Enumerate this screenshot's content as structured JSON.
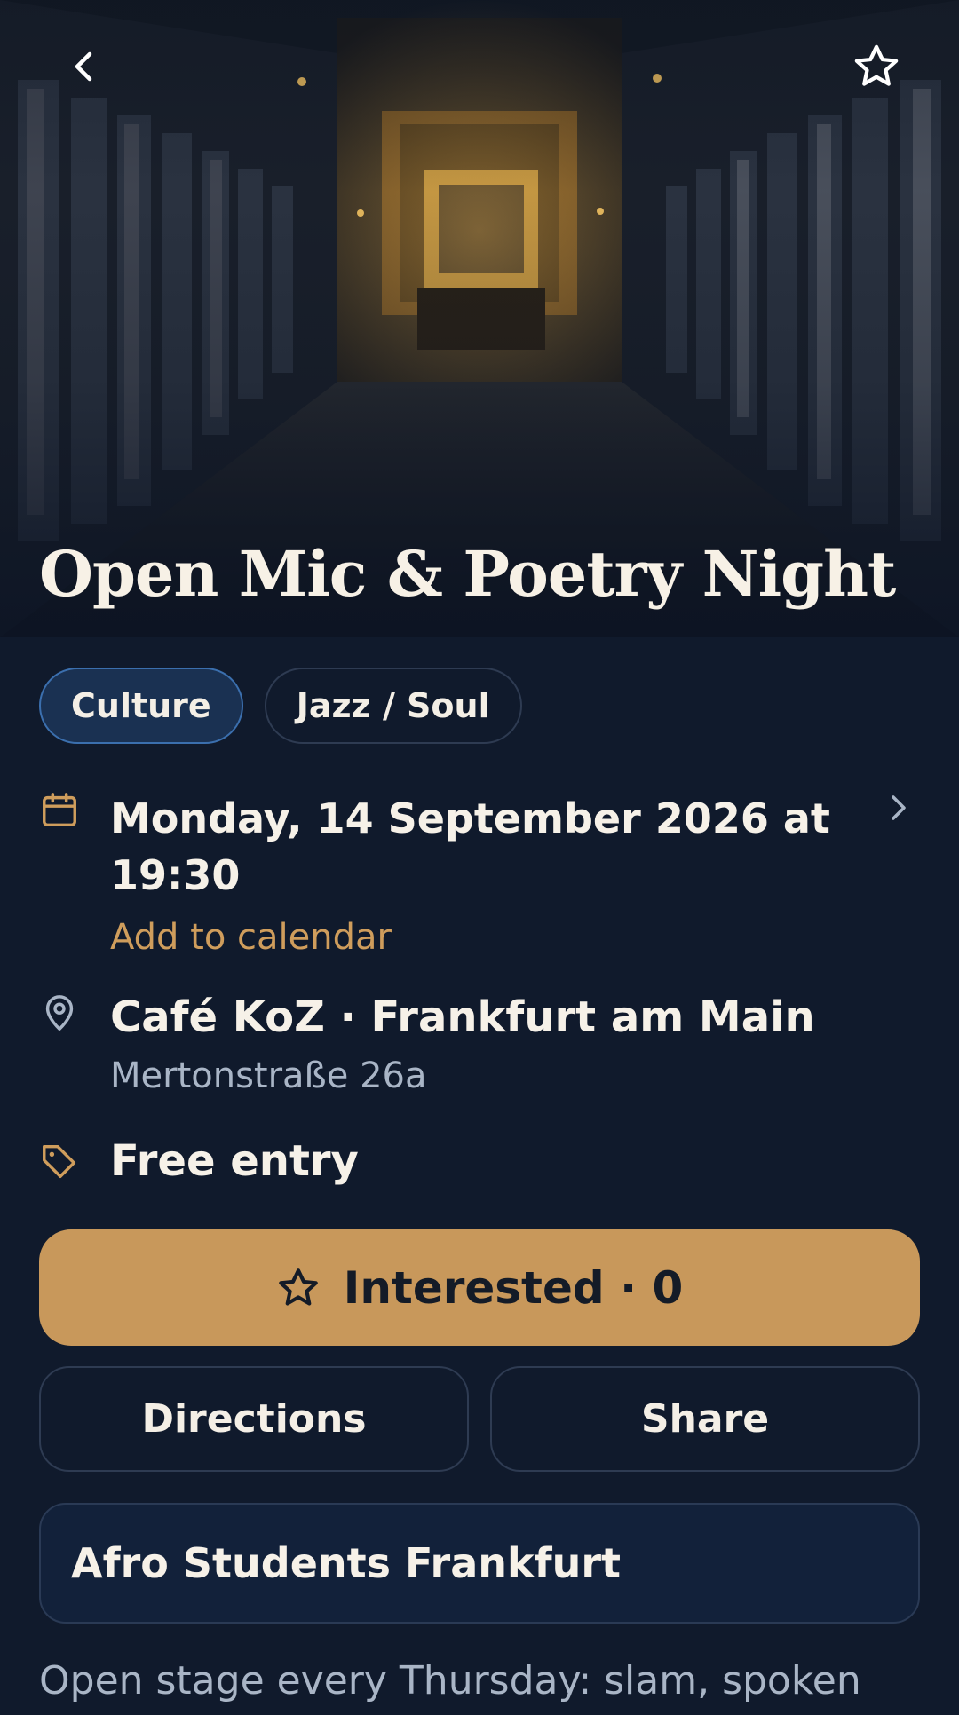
{
  "event": {
    "title": "Open Mic & Poetry Night",
    "tags": [
      "Culture",
      "Jazz / Soul"
    ],
    "datetime": "Monday, 14 September 2026 at 19:30",
    "add_to_calendar": "Add to calendar",
    "venue": "Café KoZ · Frankfurt am Main",
    "address": "Mertonstraße 26a",
    "price": "Free entry",
    "organizer": "Afro Students Frankfurt",
    "description": "Open stage every Thursday: slam, spoken"
  },
  "actions": {
    "interested_label": "Interested · 0",
    "directions_label": "Directions",
    "share_label": "Share"
  },
  "icons": {
    "back": "chevron-left-icon",
    "favorite": "star-outline-icon",
    "date": "calendar-icon",
    "location": "map-pin-icon",
    "price": "tag-icon",
    "expand": "chevron-right-icon",
    "interested": "star-outline-icon"
  },
  "colors": {
    "background": "#101a2c",
    "accent": "#c8985b",
    "accent_text": "#cf9d5c",
    "chip_active_bg": "#1a3152",
    "chip_active_border": "#3b6fae",
    "muted_text": "#a9b5c6"
  }
}
